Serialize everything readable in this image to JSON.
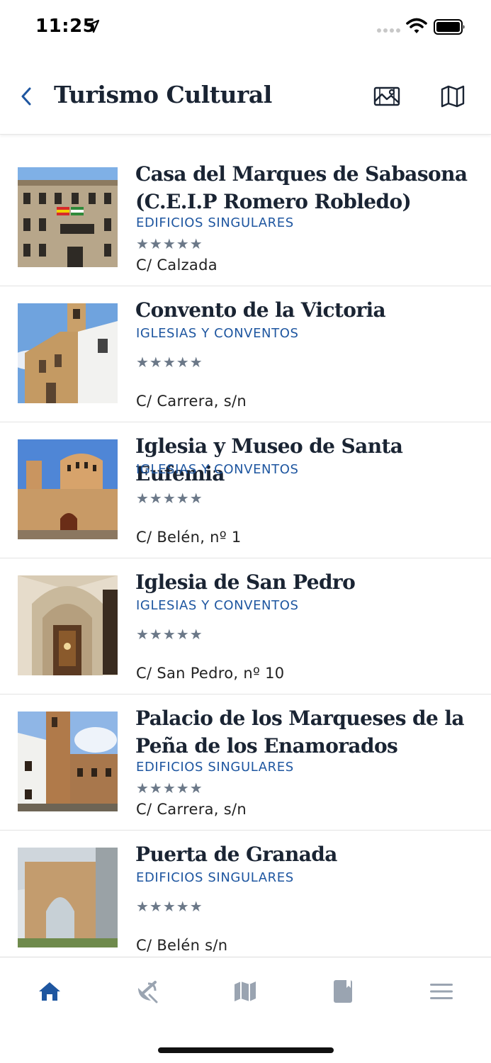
{
  "status_bar": {
    "time": "11:25"
  },
  "nav": {
    "title": "Turismo Cultural",
    "back_icon": "chevron-left-icon",
    "gallery_icon": "image-gallery-icon",
    "map_icon": "map-icon"
  },
  "colors": {
    "accent": "#1e56a0",
    "title": "#1a2433",
    "stars": "#6b7888",
    "tab_inactive": "#9aa4b1"
  },
  "items": [
    {
      "title_line1": "Casa del Marques de Sabasona",
      "title_line2": "(C.E.I.P Romero Robledo)",
      "category": "EDIFICIOS SINGULARES",
      "stars": "★★★★★",
      "address": "C/ Calzada"
    },
    {
      "title_line1": "Convento de la Victoria",
      "title_line2": "",
      "category": "IGLESIAS Y CONVENTOS",
      "stars": "★★★★★",
      "address": "C/ Carrera, s/n"
    },
    {
      "title_line1": "Iglesia y Museo de Santa Eufemia",
      "title_line2": "",
      "category": "IGLESIAS Y CONVENTOS",
      "stars": "★★★★★",
      "address": "C/ Belén, nº 1"
    },
    {
      "title_line1": "Iglesia de San Pedro",
      "title_line2": "",
      "category": "IGLESIAS Y CONVENTOS",
      "stars": "★★★★★",
      "address": "C/ San Pedro, nº 10"
    },
    {
      "title_line1": "Palacio de los Marqueses de la",
      "title_line2": "Peña de los Enamorados",
      "category": "EDIFICIOS SINGULARES",
      "stars": "★★★★★",
      "address": "C/ Carrera, s/n"
    },
    {
      "title_line1": "Puerta de Granada",
      "title_line2": "",
      "category": "EDIFICIOS SINGULARES",
      "stars": "★★★★★",
      "address": "C/ Belén s/n"
    }
  ],
  "tabs": [
    {
      "icon": "home-icon",
      "active": true
    },
    {
      "icon": "satellite-dish-icon",
      "active": false
    },
    {
      "icon": "map-icon",
      "active": false
    },
    {
      "icon": "book-icon",
      "active": false
    },
    {
      "icon": "menu-icon",
      "active": false
    }
  ]
}
